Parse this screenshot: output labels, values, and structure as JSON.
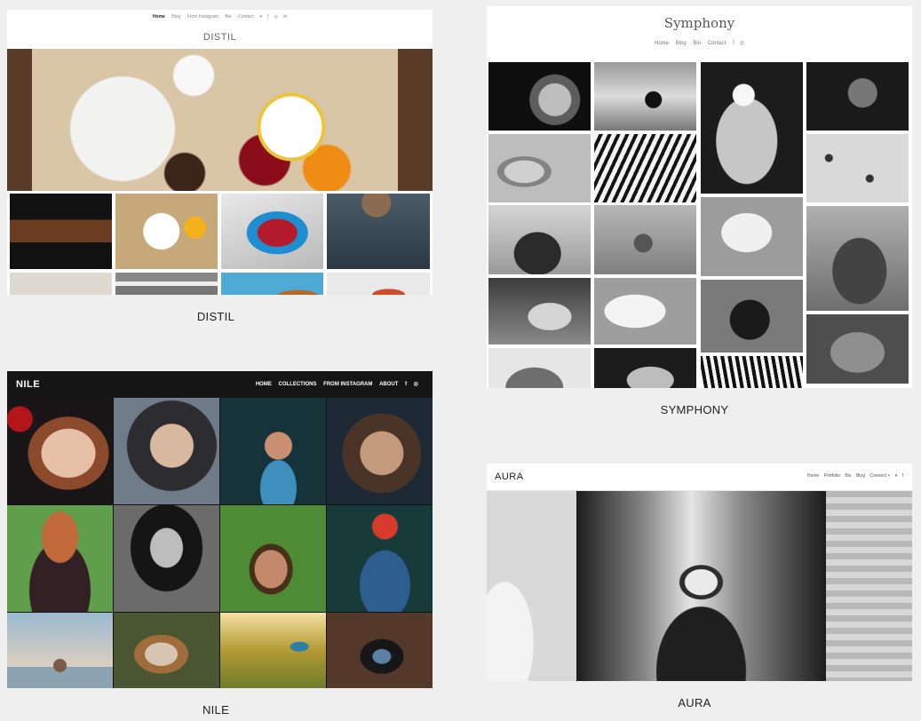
{
  "templates": {
    "distil": {
      "brand": "DISTIL",
      "nav": [
        "Home",
        "Blog",
        "From Instagram",
        "Bio",
        "Contact"
      ],
      "social_icons": [
        "twitter-icon",
        "facebook-icon",
        "instagram-icon",
        "mail-icon"
      ],
      "caption": "DISTIL"
    },
    "symphony": {
      "brand": "Symphony",
      "nav": [
        "Home",
        "Blog",
        "Bio",
        "Contact"
      ],
      "social_icons": [
        "facebook-icon",
        "instagram-icon"
      ],
      "caption": "SYMPHONY"
    },
    "nile": {
      "brand": "NILE",
      "nav": [
        "HOME",
        "COLLECTIONS",
        "FROM INSTAGRAM",
        "ABOUT"
      ],
      "social_icons": [
        "facebook-icon",
        "instagram-icon"
      ],
      "caption": "NILE"
    },
    "aura": {
      "brand": "AURA",
      "nav": [
        "Home",
        "Portfolio",
        "Bio",
        "Blog",
        "Connect +"
      ],
      "social_icons": [
        "twitter-icon",
        "facebook-icon"
      ],
      "caption": "AURA"
    }
  }
}
